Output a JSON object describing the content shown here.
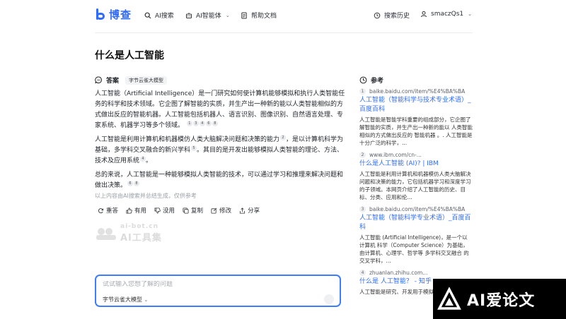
{
  "header": {
    "logo_text": "博查",
    "nav": [
      {
        "label": "AI搜索",
        "icon": "search-icon"
      },
      {
        "label": "AI智能体",
        "icon": "robot-icon"
      },
      {
        "label": "帮助文档",
        "icon": "document-icon"
      }
    ],
    "history_label": "搜索历史",
    "user_name": "smaczQs1"
  },
  "page_title": "什么是人工智能",
  "answer": {
    "label": "答案",
    "model_tag": "字节云雀大模型",
    "p1": "人工智能（Artificial Intelligence）是一门研究如何使计算机能够模拟和执行人类智能任务的科学和技术领域。它企图了解智能的实质，并生产出一种新的能以人类智能相似的方式做出反应的智能机器。人工智能包括机器人、语言识别、图像识别、自然语言处理、专家系统、机器学习等多个领域。",
    "p1_refs": [
      "1",
      "3",
      "4",
      "6",
      "8"
    ],
    "p2a": "人工智能是利用计算机和机器模仿人类大脑解决问题和决策的能力",
    "p2a_ref": "2",
    "p2b": "，是以计算机科学为基础，多学科交叉融合的新兴学科",
    "p2b_ref": "5",
    "p2c": "。其目的是开发出能够模拟人类智能的理论、方法、技术及应用系统",
    "p2c_ref": "4",
    "p2d": "。",
    "p3": "总的来说，人工智能是一种能够模拟人类智能的技术，可以通过学习和推理来解决问题和做出决策。",
    "p3_refs": [
      "6",
      "8"
    ],
    "disclaimer": "以上内容由AI搜索并总结生成，仅供参考",
    "actions": [
      {
        "label": "重答",
        "icon": "refresh-icon"
      },
      {
        "label": "有用",
        "icon": "thumbs-up-icon"
      },
      {
        "label": "没用",
        "icon": "thumbs-down-icon"
      },
      {
        "label": "复制",
        "icon": "copy-icon"
      },
      {
        "label": "修改",
        "icon": "edit-icon"
      },
      {
        "label": "分享",
        "icon": "share-icon"
      }
    ]
  },
  "watermark": {
    "top": "ai-bot.cn",
    "bottom": "AI工具集"
  },
  "input": {
    "placeholder": "试试输入您想了解的问题",
    "model": "字节云雀大模型"
  },
  "references": {
    "label": "参考",
    "items": [
      {
        "num": "1",
        "url": "baike.baidu.com/item/%E4%BA%BA",
        "title": "人工智能（智能科学与技术专业术语）_百度百科",
        "snippet": "人工智能是智能学科重要的组成部分，它企图了解智能的实质，并生产出一种新的能以 人类智能 相似的方式做出反应的 智能机器 。. 人工智能是十分广泛的科学，..."
      },
      {
        "num": "2",
        "url": "www.ibm.com/cn-...",
        "title": "什么是人工智能 (AI)? | IBM",
        "snippet": "人工智能是利用计算机和机器模仿人类大脑解决问题和决策的能力，它包括机器学习和深度学习的子领域。本网页介绍了人工智能的历史、目标、分类、应用和伦..."
      },
      {
        "num": "3",
        "url": "baike.baidu.com/item/%E4%BA%BA",
        "title": "人工智能（智能科学专业术语）_百度百科",
        "snippet": "人工智能 (Artificial Intelligence)，是一个以 计算机 科学（Computer Science）为基础，由计算机、心理学、哲学等 多学科交叉融合 的 交叉学科，..."
      },
      {
        "num": "4",
        "url": "zhuanlan.zhihu.com...",
        "title": "什么是 人工智能？ - 知乎",
        "snippet": "人工智能是研究、开发用于模拟..."
      }
    ]
  },
  "corner_badge": "AI爱论文"
}
